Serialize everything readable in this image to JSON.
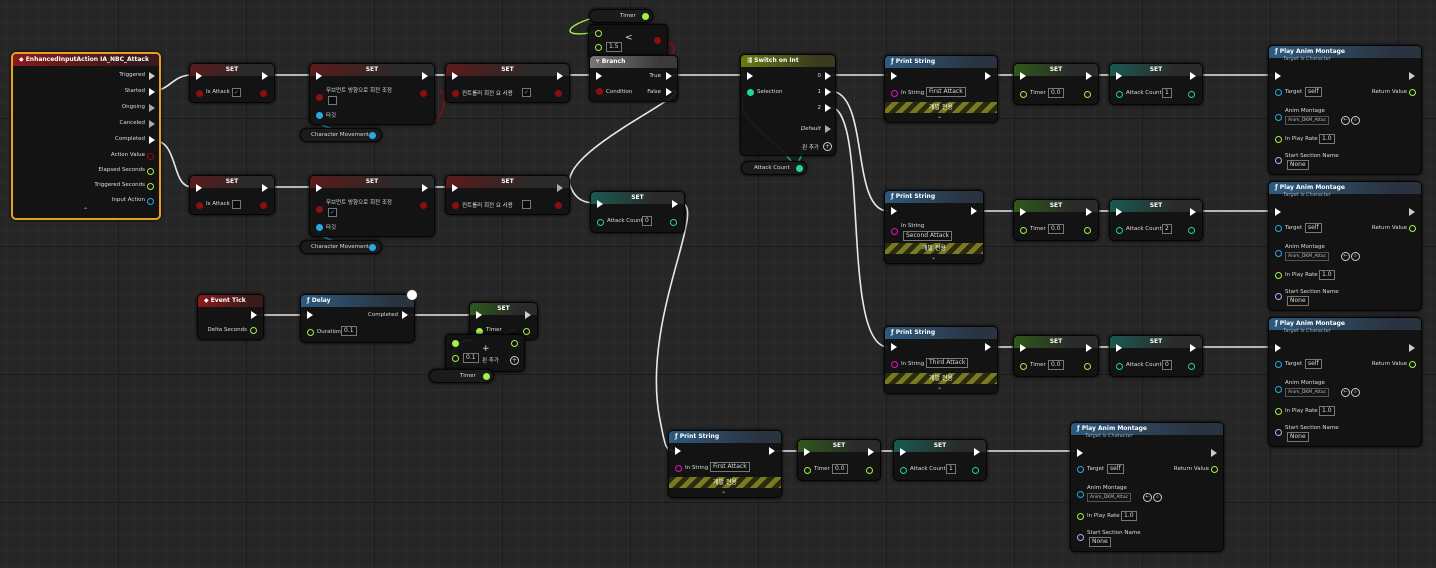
{
  "colors": {
    "exec": "#ffffff",
    "bool": "#8c0f0f",
    "float": "#a4f04a",
    "int": "#21d6a5",
    "object": "#29a8e6",
    "string": "#f20cbf",
    "struct": "#9b6ad6",
    "name": "#c8a0ff"
  },
  "input_event": {
    "title": "EnhancedInputAction IA_NBC_Attack",
    "pins": [
      "Triggered",
      "Started",
      "Ongoing",
      "Canceled",
      "Completed",
      "Action Value",
      "Elapsed Seconds",
      "Triggered Seconds",
      "Input Action"
    ]
  },
  "set1": {
    "title": "SET",
    "label": "Is Attack",
    "checked": "✓"
  },
  "set2": {
    "title": "SET",
    "label": "무브먼트 방향으로 회전 조정",
    "target": "타깃",
    "component": "Character Movement"
  },
  "set3": {
    "title": "SET",
    "label": "컨트롤러 회전 요 사용",
    "checked": "✓"
  },
  "set4": {
    "title": "SET",
    "label": "Is Attack"
  },
  "set5": {
    "title": "SET",
    "label": "무브먼트 방향으로 회전 조정",
    "checked": "✓",
    "target": "타깃",
    "component": "Character Movement"
  },
  "set6": {
    "title": "SET",
    "label": "컨트롤러 회전 요 사용"
  },
  "timer_getter": {
    "label": "Timer"
  },
  "less_node": {
    "value": "1.5",
    "op": "<"
  },
  "branch": {
    "title": "Branch",
    "condition": "Condition",
    "true_label": "True",
    "false_label": "False"
  },
  "switch": {
    "title": "Switch on Int",
    "selection": "Selection",
    "pins": [
      "0",
      "1",
      "2"
    ],
    "default": "Default",
    "add_pin": "핀 추가"
  },
  "attack_count_getter": {
    "label": "Attack Count"
  },
  "set_reset": {
    "title": "SET",
    "label": "Attack Count",
    "value": "0"
  },
  "print1": {
    "title": "Print String",
    "label": "In String",
    "value": "First Attack",
    "dev": "개발 전용"
  },
  "print2": {
    "title": "Print String",
    "label": "In String",
    "value": "Second Attack",
    "dev": "개발 전용"
  },
  "print3": {
    "title": "Print String",
    "label": "In String",
    "value": "Third Attack",
    "dev": "개발 전용"
  },
  "print4": {
    "title": "Print String",
    "label": "In String",
    "value": "First Attack",
    "dev": "개발 전용"
  },
  "timer_sets": [
    {
      "title": "SET",
      "label": "Timer",
      "value": "0.0"
    },
    {
      "title": "SET",
      "label": "Timer",
      "value": "0.0"
    },
    {
      "title": "SET",
      "label": "Timer",
      "value": "0.0"
    },
    {
      "title": "SET",
      "label": "Timer",
      "value": "0.0"
    }
  ],
  "count_sets": [
    {
      "title": "SET",
      "label": "Attack Count",
      "value": "1"
    },
    {
      "title": "SET",
      "label": "Attack Count",
      "value": "2"
    },
    {
      "title": "SET",
      "label": "Attack Count",
      "value": "0"
    },
    {
      "title": "SET",
      "label": "Attack Count",
      "value": "1"
    }
  ],
  "montages": [
    {
      "title": "Play Anim Montage",
      "subtitle": "Target is Character",
      "target": "Target",
      "self": "self",
      "return": "Return Value",
      "montage": "Anim Montage",
      "asset": "Anim_DKM_Attac",
      "rate": "In Play Rate",
      "rate_val": "1.0",
      "section": "Start Section Name",
      "section_val": "None"
    },
    {
      "title": "Play Anim Montage",
      "subtitle": "Target is Character",
      "target": "Target",
      "self": "self",
      "return": "Return Value",
      "montage": "Anim Montage",
      "asset": "Anim_DKM_Attac",
      "rate": "In Play Rate",
      "rate_val": "1.0",
      "section": "Start Section Name",
      "section_val": "None"
    },
    {
      "title": "Play Anim Montage",
      "subtitle": "Target is Character",
      "target": "Target",
      "self": "self",
      "return": "Return Value",
      "montage": "Anim Montage",
      "asset": "Anim_DKM_Attac",
      "rate": "In Play Rate",
      "rate_val": "1.0",
      "section": "Start Section Name",
      "section_val": "None"
    },
    {
      "title": "Play Anim Montage",
      "subtitle": "Target is Character",
      "target": "Target",
      "self": "self",
      "return": "Return Value",
      "montage": "Anim Montage",
      "asset": "Anim_DKM_Attac",
      "rate": "In Play Rate",
      "rate_val": "1.0",
      "section": "Start Section Name",
      "section_val": "None"
    }
  ],
  "event_tick": {
    "title": "Event Tick",
    "delta": "Delta Seconds"
  },
  "delay": {
    "title": "Delay",
    "completed": "Completed",
    "duration": "Duration",
    "value": "0.1"
  },
  "set_timer": {
    "title": "SET",
    "label": "Timer"
  },
  "add_node": {
    "value": "0.1",
    "plus": "+",
    "add_pin": "핀 추가"
  },
  "timer_getter2": {
    "label": "Timer"
  }
}
